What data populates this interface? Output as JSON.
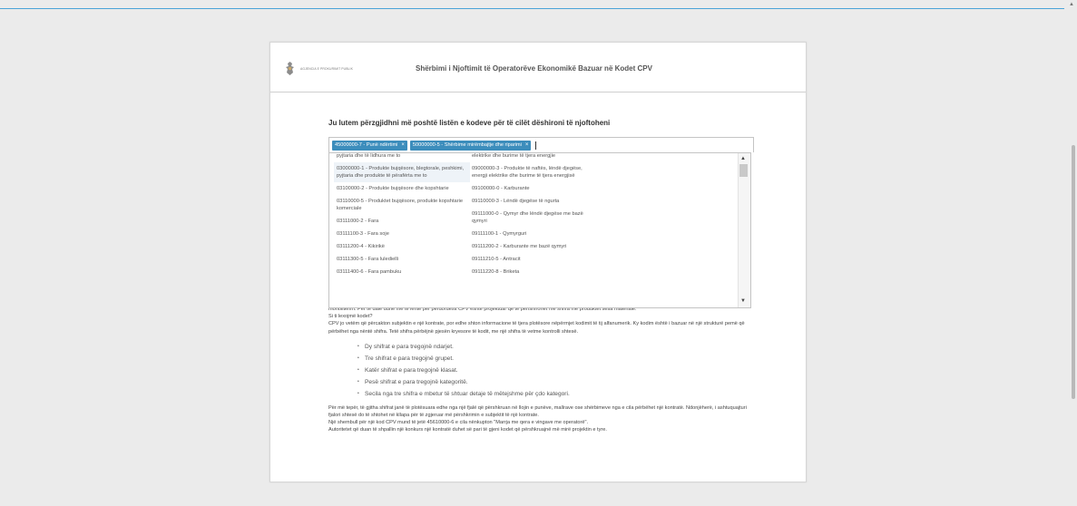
{
  "header": {
    "logo_text": "AGJENCIA E PROKURIMIT PUBLIK",
    "title": "Shërbimi i Njoftimit të Operatorëve Ekonomikë Bazuar në Kodet CPV"
  },
  "instruction": "Ju lutem përzgjidhni më poshtë listën e kodeve për të cilët dëshironi të njoftoheni",
  "selected_tags": [
    {
      "label": "45000000-7 - Punë ndërtimi",
      "remove": "×"
    },
    {
      "label": "50000000-5 - Shërbime mirëmbajtje dhe riparimi",
      "remove": "×"
    }
  ],
  "dropdown": {
    "left_options": [
      "pyjtaria dhe të lidhura me to",
      "03000000-1 - Produkte bujqësore, blegtorale, peshkimi, pyjtaria dhe produkte të përafërta me to",
      "03100000-2 - Produkte bujqësore dhe kopshtarie",
      "03110000-5 - Produktet bujqësore, produkte kopshtarie komerciale",
      "03111000-2 - Fara",
      "03111100-3 - Fara soje",
      "03111200-4 - Kikirikë",
      "03111300-5 - Fara luledielli",
      "03111400-6 - Fara pambuku"
    ],
    "right_options": [
      "elektrike dhe burime të tjera energjie",
      "09000000-3 - Produkte të naftës, lëndë djegëse, energji elektrike dhe burime të tjera energjisë",
      "09100000-0 - Karburante",
      "09110000-3 - Lëndë djegëse të ngurta",
      "09111000-0 - Qymyr dhe lëndë djegëse me bazë qymyri",
      "09111100-1 - Qymyrguri",
      "09111200-2 - Karburante me bazë qymyri",
      "09111210-5 - Antracit",
      "09111220-8 - Briketa"
    ]
  },
  "body": {
    "partial_line": "monoliterim. Për të dalë duhe me të lehtë për përdoruesit CPV është projektuar që të përfshirohet me shifra me produktet sesa materiale.",
    "question": "Si ti lexojmë kodet?",
    "paragraph1": "CPV jo vetëm që përcakton subjektin e një kontrate, por edhe shton informacione të tjera plotësore nëpërmjet kodimit të tij alfanumerik. Ky kodim është i bazuar në një strukturë pemë që përbëhet nga nëntë shifra. Tetë shifra përbëjnë pjesën kryesore të kodit, me një shifra të vetme kontrolli shtesë.",
    "bullets": [
      "Dy shifrat e para tregojnë ndarjet.",
      "Tre shifrat e para tregojnë grupet.",
      "Katër shifrat e para tregojnë klasat.",
      "Pesë shifrat e para tregojnë kategoritë.",
      "Secila nga tre shifra e mbetur të shtuar detaje të mëtejshme për çdo kategori."
    ],
    "paragraph2": "Për më tepër, të gjitha shifrat janë të plotësuara edhe nga një fjalë që përshkruan në llojin e punëve, mallrave ose shërbimeve nga e cila përbëhet një kontratë. Ndonjëherë, i ashtuquajturi fjalori shtesë do të shtohet në kllapa për të zgjeruar më përshkrimin e subjektit të një kontrate.",
    "paragraph3": "Një shembull për një kod CPV mund të jetë 45610000-6 e cila nënkupton \"Marrja me qera e vingave me operatorë\".",
    "paragraph4": "Autoritetet që duan të shpallin një konkurs një kontratë duhet së pari të gjeni kodet që përshkruajnë më mirë projektin e tyre."
  }
}
